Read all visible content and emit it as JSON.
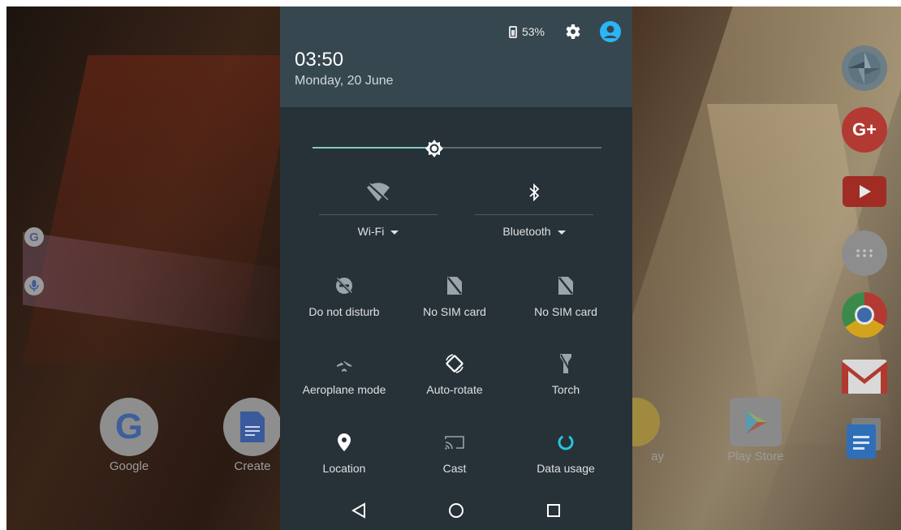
{
  "home": {
    "dock_apps": [
      {
        "label": "Google",
        "icon": "google-icon"
      },
      {
        "label": "Create",
        "icon": "docs-create-icon"
      },
      {
        "label": "ay",
        "icon": "play-games-icon"
      },
      {
        "label": "Play Store",
        "icon": "play-store-icon"
      }
    ],
    "side_widgets": [
      "google-search-icon",
      "microphone-icon"
    ],
    "right_column": [
      "photos-icon",
      "google-plus-icon",
      "youtube-icon",
      "app-drawer-icon",
      "chrome-icon",
      "gmail-icon",
      "docs-icon"
    ],
    "google_plus_text": "G+",
    "google_letter": "G"
  },
  "shade": {
    "battery_text": "53%",
    "clock": "03:50",
    "date": "Monday, 20 June",
    "brightness_level": 0.42,
    "wifi_label": "Wi-Fi",
    "bluetooth_label": "Bluetooth",
    "tiles": [
      {
        "label": "Do not disturb",
        "icon": "do-not-disturb-icon"
      },
      {
        "label": "No SIM card",
        "icon": "no-sim-icon"
      },
      {
        "label": "No SIM card",
        "icon": "no-sim-icon"
      },
      {
        "label": "Aeroplane mode",
        "icon": "airplane-icon"
      },
      {
        "label": "Auto-rotate",
        "icon": "auto-rotate-icon"
      },
      {
        "label": "Torch",
        "icon": "torch-icon"
      },
      {
        "label": "Location",
        "icon": "location-icon"
      },
      {
        "label": "Cast",
        "icon": "cast-icon"
      },
      {
        "label": "Data usage",
        "icon": "data-usage-icon"
      }
    ]
  },
  "navbar": [
    "back-icon",
    "home-icon",
    "recents-icon"
  ],
  "colors": {
    "shade_bg": "#263238",
    "header_bg": "#37474f",
    "accent": "#80cbc4"
  }
}
